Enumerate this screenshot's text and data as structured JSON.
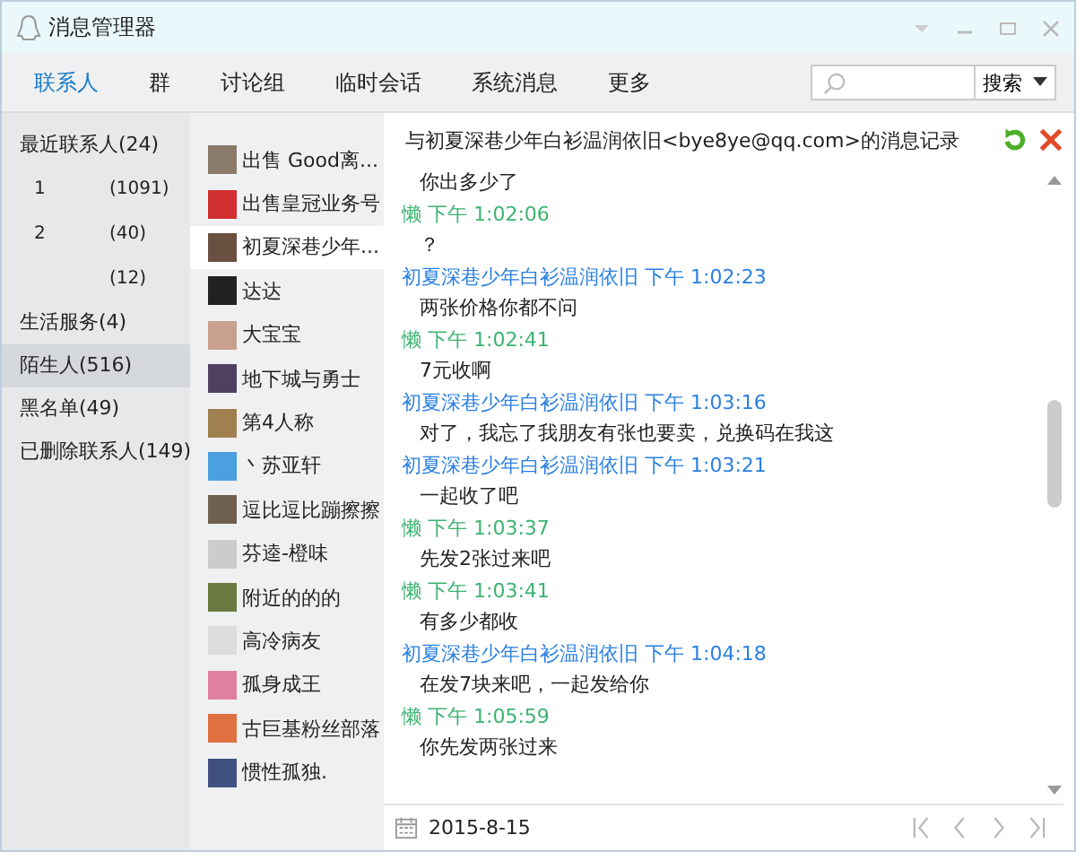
{
  "window": {
    "title": "消息管理器"
  },
  "tabs": [
    {
      "label": "联系人",
      "selected": true
    },
    {
      "label": "群",
      "selected": false
    },
    {
      "label": "讨论组",
      "selected": false
    },
    {
      "label": "临时会话",
      "selected": false
    },
    {
      "label": "系统消息",
      "selected": false
    },
    {
      "label": "更多",
      "selected": false
    }
  ],
  "search": {
    "button": "搜索"
  },
  "sidebar": {
    "items": [
      {
        "label": "最近联系人(24)",
        "selected": false,
        "children": [
          {
            "name": "1",
            "count": "(1091)"
          },
          {
            "name": "2",
            "count": "(40)"
          },
          {
            "count": "(12)"
          }
        ]
      },
      {
        "label": "生活服务(4)",
        "selected": false
      },
      {
        "label": "陌生人(516)",
        "selected": true
      },
      {
        "label": "黑名单(49)",
        "selected": false
      },
      {
        "label": "已删除联系人(149)",
        "selected": false
      }
    ]
  },
  "contacts": [
    {
      "name": "出售 Good离...",
      "selected": false
    },
    {
      "name": "出售皇冠业务号",
      "selected": false
    },
    {
      "name": "初夏深巷少年...",
      "selected": true
    },
    {
      "name": "达达",
      "selected": false
    },
    {
      "name": "大宝宝",
      "selected": false
    },
    {
      "name": "地下城与勇士",
      "selected": false
    },
    {
      "name": "第4人称",
      "selected": false
    },
    {
      "name": "丶苏亚轩",
      "selected": false
    },
    {
      "name": "逗比逗比蹦擦擦",
      "selected": false
    },
    {
      "name": "芬逵-橙味",
      "selected": false
    },
    {
      "name": "附近的的的",
      "selected": false
    },
    {
      "name": "高冷病友",
      "selected": false
    },
    {
      "name": "孤身成王",
      "selected": false
    },
    {
      "name": "古巨基粉丝部落",
      "selected": false
    },
    {
      "name": "惯性孤独.",
      "selected": false
    }
  ],
  "chat": {
    "title": "与初夏深巷少年白衫温润依旧<bye8ye@qq.com>的消息记录",
    "messages": [
      {
        "text": "你出多少了"
      },
      {
        "kind": "me",
        "header": "懒 下午 1:02:06",
        "text": "？"
      },
      {
        "kind": "other",
        "header": "初夏深巷少年白衫温润依旧 下午 1:02:23",
        "text": "两张价格你都不问"
      },
      {
        "kind": "me",
        "header": "懒 下午 1:02:41",
        "text": "7元收啊"
      },
      {
        "kind": "other",
        "header": "初夏深巷少年白衫温润依旧 下午 1:03:16",
        "text": "对了，我忘了我朋友有张也要卖，兑换码在我这"
      },
      {
        "kind": "other",
        "header": "初夏深巷少年白衫温润依旧 下午 1:03:21",
        "text": "一起收了吧"
      },
      {
        "kind": "me",
        "header": "懒 下午 1:03:37",
        "text": "先发2张过来吧"
      },
      {
        "kind": "me",
        "header": "懒 下午 1:03:41",
        "text": "有多少都收"
      },
      {
        "kind": "other",
        "header": "初夏深巷少年白衫温润依旧 下午 1:04:18",
        "text": "在发7块来吧，一起发给你"
      },
      {
        "kind": "me",
        "header": "懒 下午 1:05:59",
        "text": "你先发两张过来"
      }
    ],
    "date": "2015-8-15"
  }
}
